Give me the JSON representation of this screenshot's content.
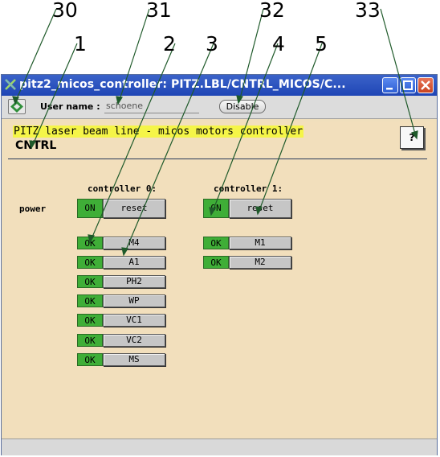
{
  "callouts": {
    "c30": "30",
    "c31": "31",
    "c32": "32",
    "c33": "33",
    "c1": "1",
    "c2": "2",
    "c3": "3",
    "c4": "4",
    "c5": "5"
  },
  "window": {
    "title": "pitz2_micos_controller: PITZ.LBL/CNTRL_MICOS/C..."
  },
  "toolbar": {
    "user_label": "User name :",
    "user_value": "schoene",
    "disable_label": "Disable"
  },
  "header": {
    "subtitle": "PITZ laser beam line - micos motors controller",
    "name": "CNTRL",
    "help_label": "?"
  },
  "controller0": {
    "heading": "controller 0:",
    "power_status": "ON",
    "reset_label": "reset",
    "motors": [
      {
        "status": "OK",
        "label": "M4"
      },
      {
        "status": "OK",
        "label": "A1"
      },
      {
        "status": "OK",
        "label": "PH2"
      },
      {
        "status": "OK",
        "label": "WP"
      },
      {
        "status": "OK",
        "label": "VC1"
      },
      {
        "status": "OK",
        "label": "VC2"
      },
      {
        "status": "OK",
        "label": "MS"
      }
    ]
  },
  "controller1": {
    "heading": "controller 1:",
    "power_status": "ON",
    "reset_label": "reset",
    "motors": [
      {
        "status": "OK",
        "label": "M1"
      },
      {
        "status": "OK",
        "label": "M2"
      }
    ]
  },
  "power_label": "power",
  "colors": {
    "status_green": "#3fae37",
    "subtitle_highlight": "#f5f548",
    "panel_bg": "#f2dfbc",
    "titlebar_blue": "#1f45b5"
  }
}
